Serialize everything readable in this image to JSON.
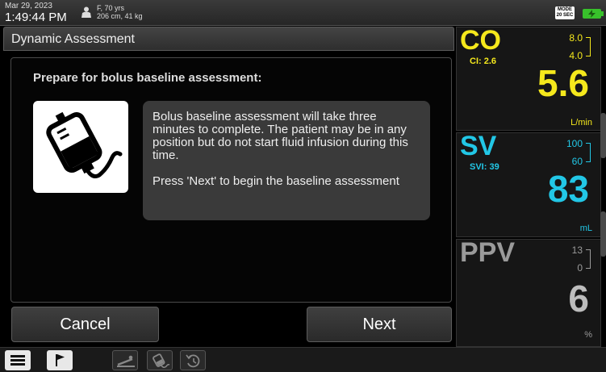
{
  "status_bar": {
    "date": "Mar 29, 2023",
    "time": "1:49:44 PM",
    "patient_line1": "F, 70 yrs",
    "patient_line2": "206 cm, 41 kg",
    "patient_icon": "person-icon",
    "mode_line1": "MODE",
    "mode_line2": "20 SEC",
    "battery_icon": "battery-charging-icon",
    "battery_color": "#38c12b"
  },
  "dialog": {
    "title": "Dynamic Assessment",
    "prompt": "Prepare for bolus baseline assessment:",
    "icon": "iv-bag-icon",
    "message_p1": "Bolus baseline assessment will take three minutes to complete. The patient may be in any position but do not start fluid infusion during this time.",
    "message_p2": "Press 'Next' to begin the baseline assessment",
    "cancel_label": "Cancel",
    "next_label": "Next"
  },
  "parameters": {
    "co": {
      "name": "CO",
      "sub": "CI: 2.6",
      "target_high": "8.0",
      "target_low": "4.0",
      "value": "5.6",
      "unit": "L/min",
      "color": "#f5e81c"
    },
    "sv": {
      "name": "SV",
      "sub": "SVI: 39",
      "target_high": "100",
      "target_low": "60",
      "value": "83",
      "unit": "mL",
      "color": "#22c7e6"
    },
    "ppv": {
      "name": "PPV",
      "target_high": "13",
      "target_low": "0",
      "value": "6",
      "unit": "%",
      "color": "#9a9a9a"
    }
  },
  "toolbar": {
    "items": [
      "menu-icon",
      "flag-icon",
      "patient-bed-icon",
      "iv-bag-icon",
      "history-icon"
    ]
  }
}
